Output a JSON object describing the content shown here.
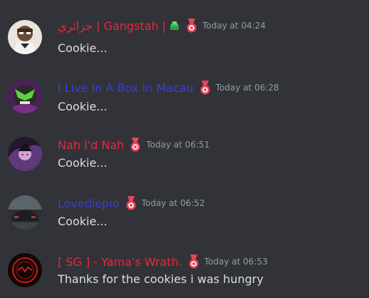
{
  "colors": {
    "background": "#313338",
    "text": "#dbdee1",
    "timestamp": "#949ba4",
    "red_name": "#e8283c",
    "blue_name": "#3a3fd0",
    "badge": "#e8455a"
  },
  "messages": [
    {
      "username": "جزائري | Gangstah |",
      "name_color": "#e8283c",
      "extra_icon": "money-stack-icon",
      "badge": "medal-icon",
      "timestamp": "Today at 04:24",
      "text": "Cookie..."
    },
    {
      "username": "I Live In A Box In Macau",
      "name_color": "#3a3fd0",
      "badge": "medal-icon",
      "timestamp": "Today at 06:28",
      "text": "Cookie..."
    },
    {
      "username": "Nah I'd Nah",
      "name_color": "#e8283c",
      "badge": "medal-icon",
      "timestamp": "Today at 06:51",
      "text": "Cookie..."
    },
    {
      "username": "Lovediepio",
      "name_color": "#3a3fd0",
      "badge": "medal-icon",
      "timestamp": "Today at 06:52",
      "text": "Cookie..."
    },
    {
      "username": "[ SG ] - Yama's Wrath.",
      "name_color": "#e8283c",
      "badge": "medal-icon",
      "timestamp": "Today at 06:53",
      "text": "Thanks for the cookies i was hungry"
    }
  ]
}
